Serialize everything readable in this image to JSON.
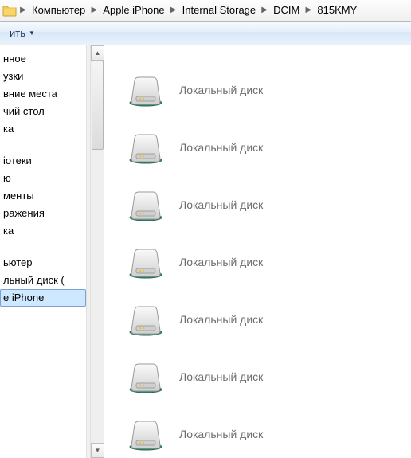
{
  "breadcrumb": [
    {
      "label": "Компьютер"
    },
    {
      "label": "Apple iPhone"
    },
    {
      "label": "Internal Storage"
    },
    {
      "label": "DCIM"
    },
    {
      "label": "815KMY"
    }
  ],
  "toolbar": {
    "organize_label": "ить"
  },
  "sidebar": {
    "group1": [
      "нное",
      "узки",
      "вние места",
      "чий стол",
      "ка"
    ],
    "group2": [
      "iотеки",
      "ю",
      "менты",
      "ражения",
      "ка"
    ],
    "group3": [
      "ьютер",
      "льный диск (",
      "e iPhone"
    ],
    "selected": "e iPhone"
  },
  "content": {
    "items": [
      {
        "label": "Локальный диск"
      },
      {
        "label": "Локальный диск"
      },
      {
        "label": "Локальный диск"
      },
      {
        "label": "Локальный диск"
      },
      {
        "label": "Локальный диск"
      },
      {
        "label": "Локальный диск"
      },
      {
        "label": "Локальный диск"
      }
    ]
  }
}
